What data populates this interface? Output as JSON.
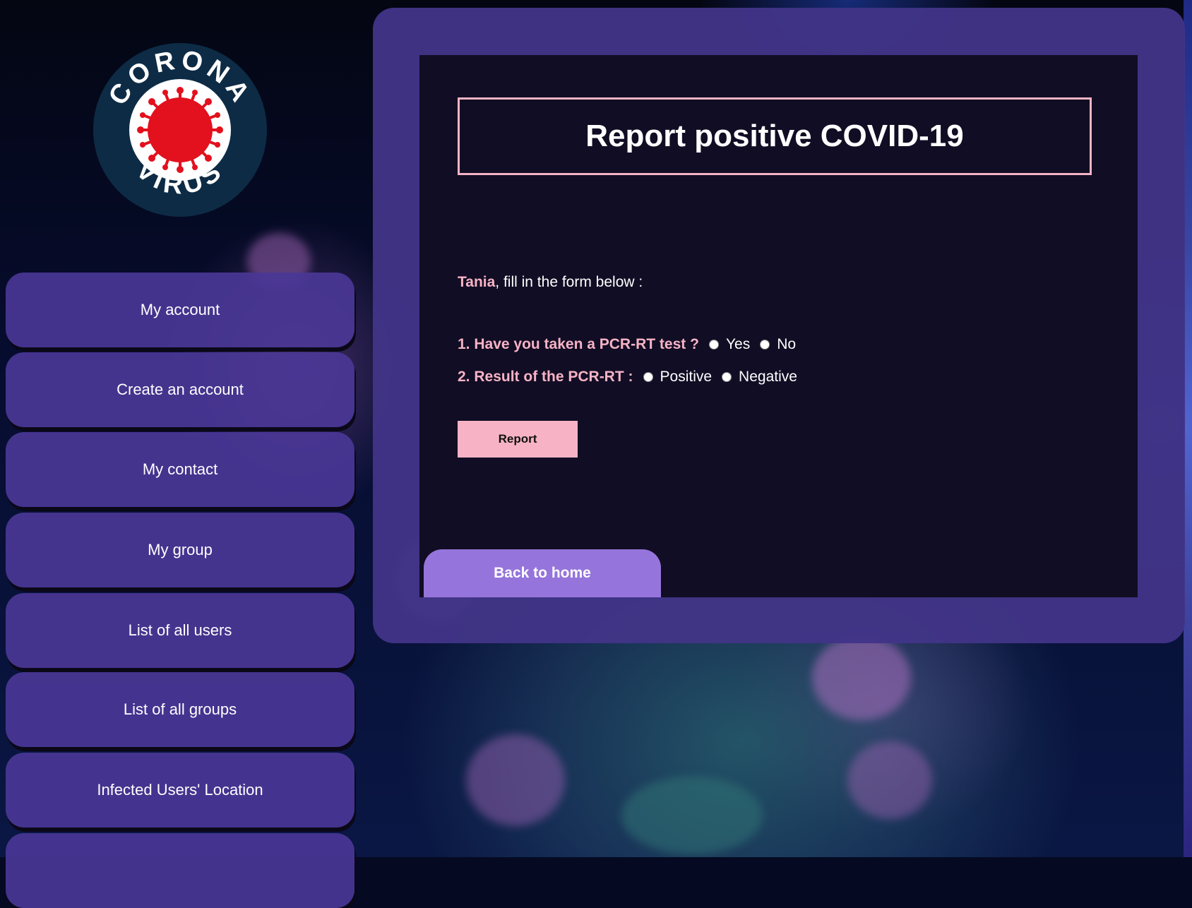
{
  "logo": {
    "top_text": "CORONA",
    "bottom_text": "VIRUS",
    "colors": {
      "ring": "#0d2b45",
      "virus": "#e3101d",
      "inner": "#ffffff"
    }
  },
  "sidebar": {
    "items": [
      {
        "label": "My account"
      },
      {
        "label": "Create an account"
      },
      {
        "label": "My contact"
      },
      {
        "label": "My group"
      },
      {
        "label": "List of all users"
      },
      {
        "label": "List of all groups"
      },
      {
        "label": "Infected Users' Location"
      },
      {
        "label": ""
      }
    ]
  },
  "main": {
    "title": "Report positive COVID-19",
    "greeting": {
      "name": "Tania",
      "text": ", fill in the form below :"
    },
    "questions": [
      {
        "label": "1. Have you taken a PCR-RT test ?",
        "options": [
          "Yes",
          "No"
        ]
      },
      {
        "label": "2. Result of the PCR-RT :",
        "options": [
          "Positive",
          "Negative"
        ]
      }
    ],
    "report_button": "Report",
    "back_button": "Back to home"
  },
  "colors": {
    "accent_pink": "#f7b3c5",
    "panel_purple": "#42348a",
    "nav_purple": "#4a3796",
    "back_button": "#9575db"
  }
}
